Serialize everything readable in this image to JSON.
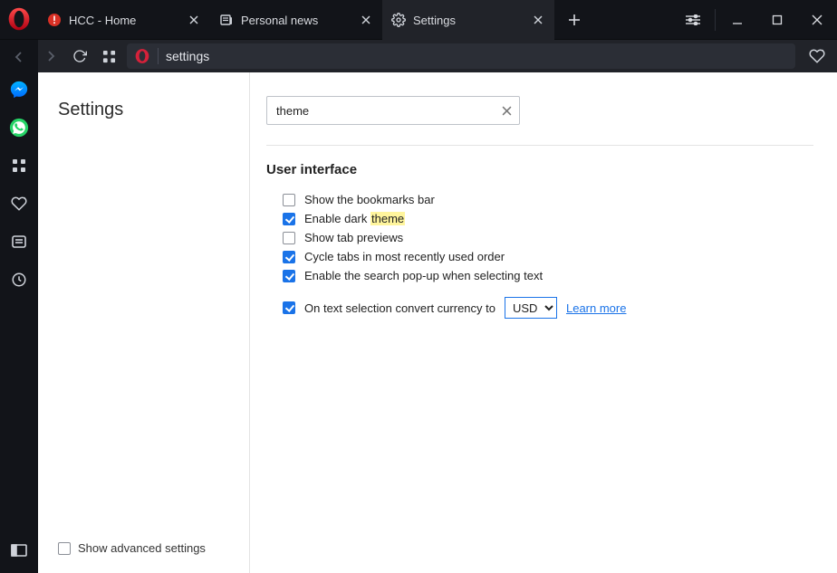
{
  "tabs": [
    {
      "label": "HCC - Home",
      "icon": "red-badge"
    },
    {
      "label": "Personal news",
      "icon": "news"
    },
    {
      "label": "Settings",
      "icon": "gear"
    }
  ],
  "active_tab_index": 2,
  "address_bar_text": "settings",
  "settings": {
    "page_title": "Settings",
    "search_value": "theme",
    "search_highlight": "theme",
    "advanced_label": "Show advanced settings",
    "advanced_checked": false,
    "section": {
      "heading": "User interface",
      "options": [
        {
          "label": "Show the bookmarks bar",
          "checked": false
        },
        {
          "label": "Enable dark theme",
          "checked": true
        },
        {
          "label": "Show tab previews",
          "checked": false
        },
        {
          "label": "Cycle tabs in most recently used order",
          "checked": true
        },
        {
          "label": "Enable the search pop-up when selecting text",
          "checked": true
        }
      ],
      "currency": {
        "label": "On text selection convert currency to",
        "checked": true,
        "selected": "USD",
        "link": "Learn more"
      }
    }
  }
}
